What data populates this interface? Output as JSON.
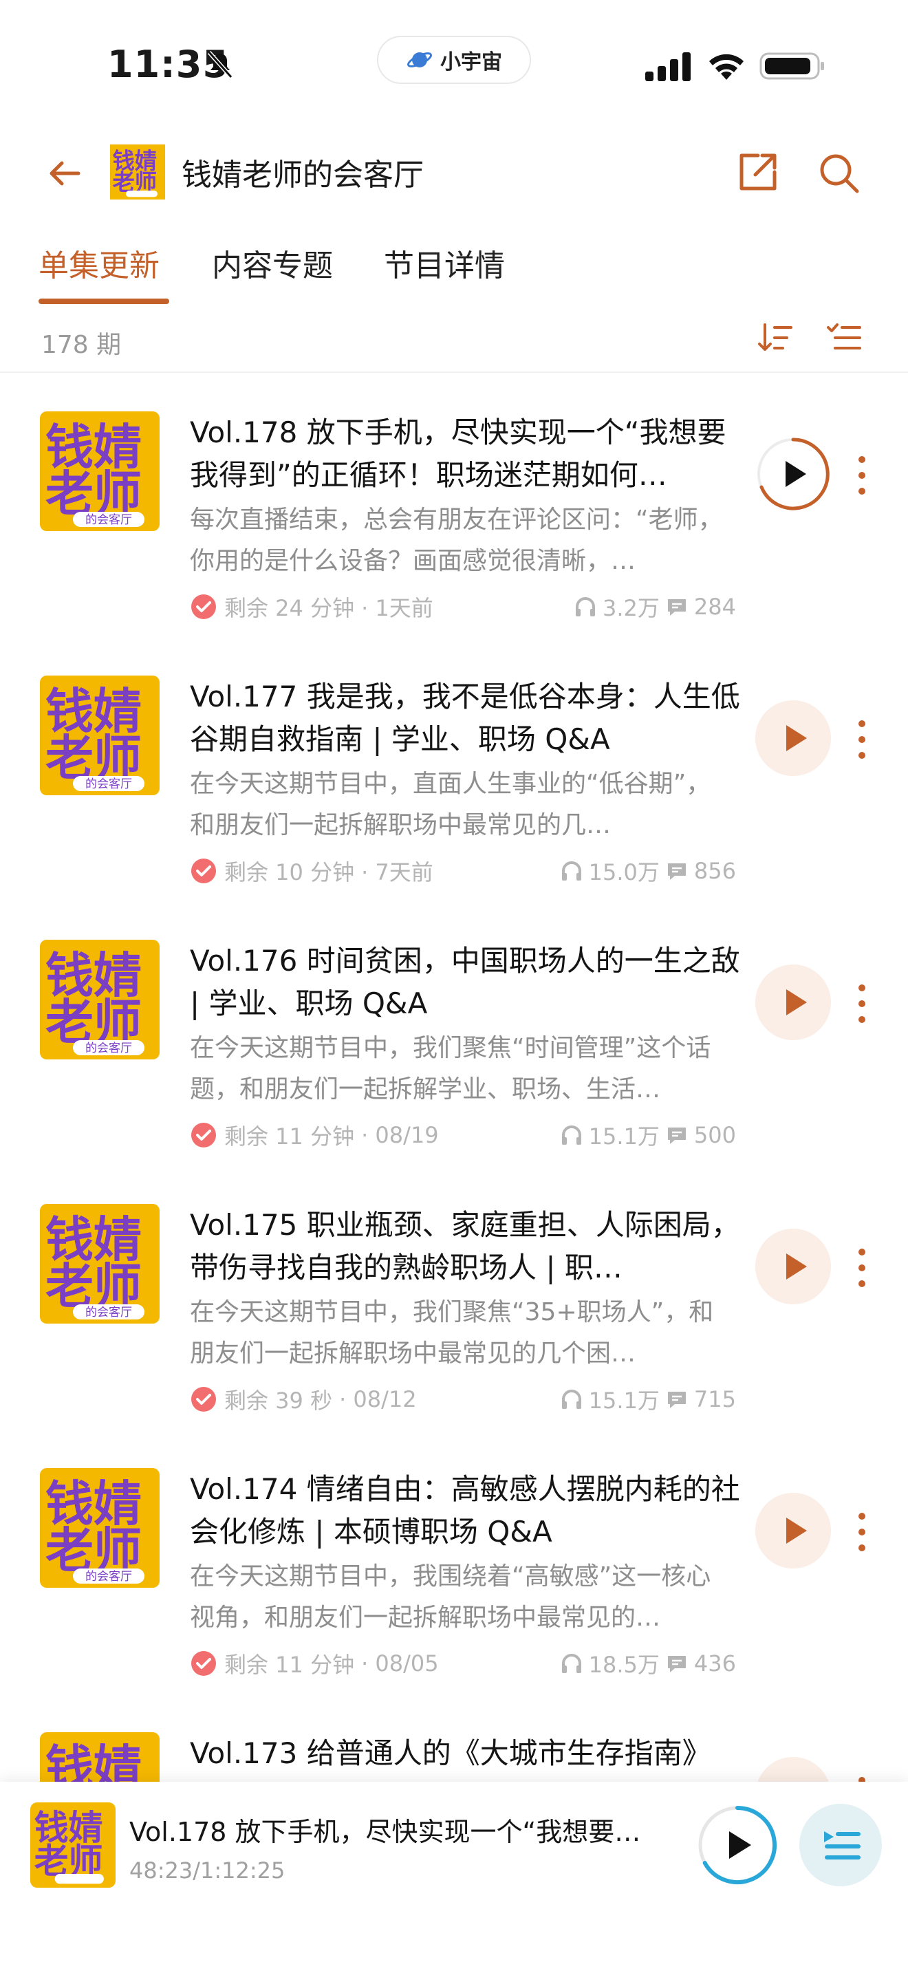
{
  "status_bar": {
    "time": "11:35",
    "island_label": "小宇宙"
  },
  "header": {
    "title": "钱婧老师的会客厅"
  },
  "tabs": [
    {
      "label": "单集更新",
      "active": true
    },
    {
      "label": "内容专题",
      "active": false
    },
    {
      "label": "节目详情",
      "active": false
    }
  ],
  "episode_count": "178 期",
  "episodes": [
    {
      "title": "Vol.178 放下手机，尽快实现一个“我想要我得到”的正循环！职场迷茫期如何…",
      "description": "每次直播结束，总会有朋友在评论区问：“老师，你用的是什么设备？画面感觉很清晰，…",
      "remaining": "剩余 24 分钟",
      "date": "· 1天前",
      "plays": "3.2万",
      "comments": "284",
      "playing": true
    },
    {
      "title": "Vol.177 我是我，我不是低谷本身：人生低谷期自救指南 | 学业、职场 Q&A",
      "description": "在今天这期节目中，直面人生事业的“低谷期”，和朋友们一起拆解职场中最常见的几…",
      "remaining": "剩余 10 分钟",
      "date": "· 7天前",
      "plays": "15.0万",
      "comments": "856",
      "playing": false
    },
    {
      "title": "Vol.176 时间贫困，中国职场人的一生之敌 | 学业、职场 Q&A",
      "description": "在今天这期节目中，我们聚焦“时间管理”这个话题，和朋友们一起拆解学业、职场、生活…",
      "remaining": "剩余 11 分钟",
      "date": "· 08/19",
      "plays": "15.1万",
      "comments": "500",
      "playing": false
    },
    {
      "title": "Vol.175 职业瓶颈、家庭重担、人际困局，带伤寻找自我的熟龄职场人 | 职…",
      "description": "在今天这期节目中，我们聚焦“35+职场人”，和朋友们一起拆解职场中最常见的几个困…",
      "remaining": "剩余 39 秒",
      "date": "· 08/12",
      "plays": "15.1万",
      "comments": "715",
      "playing": false
    },
    {
      "title": "Vol.174 情绪自由：高敏感人摆脱内耗的社会化修炼 | 本硕博职场 Q&A",
      "description": "在今天这期节目中，我围绕着“高敏感”这一核心视角，和朋友们一起拆解职场中最常见的…",
      "remaining": "剩余 11 分钟",
      "date": "· 08/05",
      "plays": "18.5万",
      "comments": "436",
      "playing": false
    },
    {
      "title": "Vol.173 给普通人的《大城市生存指南》",
      "description": "",
      "remaining": "",
      "date": "",
      "plays": "",
      "comments": "",
      "playing": false
    }
  ],
  "mini_player": {
    "title": "Vol.178 放下手机，尽快实现一个“我想要我…",
    "progress_text": "48:23/1:12:25",
    "progress": 0.67
  },
  "cover_text": {
    "line1": "钱婧",
    "line2": "老师",
    "sub": "的会客厅"
  },
  "colors": {
    "accent": "#c4602a",
    "cover_bg": "#f5b800",
    "cover_text": "#7b3fc4",
    "play_progress": "#2aa7d9"
  },
  "icons": {
    "back": "arrow-left-icon",
    "share": "share-icon",
    "search": "search-icon",
    "sort": "sort-icon",
    "filter": "filter-list-icon",
    "check": "check-circle-icon",
    "headphones": "headphones-icon",
    "comment": "comment-icon",
    "play": "play-icon",
    "more": "more-vertical-icon",
    "playlist": "playlist-icon"
  }
}
